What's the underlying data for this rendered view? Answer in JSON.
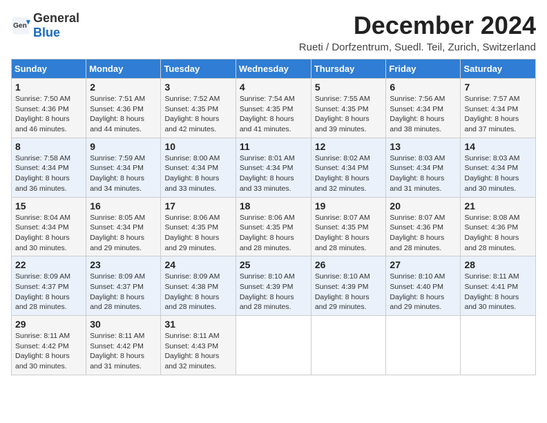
{
  "header": {
    "logo_general": "General",
    "logo_blue": "Blue",
    "month_title": "December 2024",
    "location": "Rueti / Dorfzentrum, Suedl. Teil, Zurich, Switzerland"
  },
  "calendar": {
    "weekdays": [
      "Sunday",
      "Monday",
      "Tuesday",
      "Wednesday",
      "Thursday",
      "Friday",
      "Saturday"
    ],
    "weeks": [
      [
        {
          "day": "1",
          "sunrise": "7:50 AM",
          "sunset": "4:36 PM",
          "daylight": "8 hours and 46 minutes."
        },
        {
          "day": "2",
          "sunrise": "7:51 AM",
          "sunset": "4:36 PM",
          "daylight": "8 hours and 44 minutes."
        },
        {
          "day": "3",
          "sunrise": "7:52 AM",
          "sunset": "4:35 PM",
          "daylight": "8 hours and 42 minutes."
        },
        {
          "day": "4",
          "sunrise": "7:54 AM",
          "sunset": "4:35 PM",
          "daylight": "8 hours and 41 minutes."
        },
        {
          "day": "5",
          "sunrise": "7:55 AM",
          "sunset": "4:35 PM",
          "daylight": "8 hours and 39 minutes."
        },
        {
          "day": "6",
          "sunrise": "7:56 AM",
          "sunset": "4:34 PM",
          "daylight": "8 hours and 38 minutes."
        },
        {
          "day": "7",
          "sunrise": "7:57 AM",
          "sunset": "4:34 PM",
          "daylight": "8 hours and 37 minutes."
        }
      ],
      [
        {
          "day": "8",
          "sunrise": "7:58 AM",
          "sunset": "4:34 PM",
          "daylight": "8 hours and 36 minutes."
        },
        {
          "day": "9",
          "sunrise": "7:59 AM",
          "sunset": "4:34 PM",
          "daylight": "8 hours and 34 minutes."
        },
        {
          "day": "10",
          "sunrise": "8:00 AM",
          "sunset": "4:34 PM",
          "daylight": "8 hours and 33 minutes."
        },
        {
          "day": "11",
          "sunrise": "8:01 AM",
          "sunset": "4:34 PM",
          "daylight": "8 hours and 33 minutes."
        },
        {
          "day": "12",
          "sunrise": "8:02 AM",
          "sunset": "4:34 PM",
          "daylight": "8 hours and 32 minutes."
        },
        {
          "day": "13",
          "sunrise": "8:03 AM",
          "sunset": "4:34 PM",
          "daylight": "8 hours and 31 minutes."
        },
        {
          "day": "14",
          "sunrise": "8:03 AM",
          "sunset": "4:34 PM",
          "daylight": "8 hours and 30 minutes."
        }
      ],
      [
        {
          "day": "15",
          "sunrise": "8:04 AM",
          "sunset": "4:34 PM",
          "daylight": "8 hours and 30 minutes."
        },
        {
          "day": "16",
          "sunrise": "8:05 AM",
          "sunset": "4:34 PM",
          "daylight": "8 hours and 29 minutes."
        },
        {
          "day": "17",
          "sunrise": "8:06 AM",
          "sunset": "4:35 PM",
          "daylight": "8 hours and 29 minutes."
        },
        {
          "day": "18",
          "sunrise": "8:06 AM",
          "sunset": "4:35 PM",
          "daylight": "8 hours and 28 minutes."
        },
        {
          "day": "19",
          "sunrise": "8:07 AM",
          "sunset": "4:35 PM",
          "daylight": "8 hours and 28 minutes."
        },
        {
          "day": "20",
          "sunrise": "8:07 AM",
          "sunset": "4:36 PM",
          "daylight": "8 hours and 28 minutes."
        },
        {
          "day": "21",
          "sunrise": "8:08 AM",
          "sunset": "4:36 PM",
          "daylight": "8 hours and 28 minutes."
        }
      ],
      [
        {
          "day": "22",
          "sunrise": "8:09 AM",
          "sunset": "4:37 PM",
          "daylight": "8 hours and 28 minutes."
        },
        {
          "day": "23",
          "sunrise": "8:09 AM",
          "sunset": "4:37 PM",
          "daylight": "8 hours and 28 minutes."
        },
        {
          "day": "24",
          "sunrise": "8:09 AM",
          "sunset": "4:38 PM",
          "daylight": "8 hours and 28 minutes."
        },
        {
          "day": "25",
          "sunrise": "8:10 AM",
          "sunset": "4:39 PM",
          "daylight": "8 hours and 28 minutes."
        },
        {
          "day": "26",
          "sunrise": "8:10 AM",
          "sunset": "4:39 PM",
          "daylight": "8 hours and 29 minutes."
        },
        {
          "day": "27",
          "sunrise": "8:10 AM",
          "sunset": "4:40 PM",
          "daylight": "8 hours and 29 minutes."
        },
        {
          "day": "28",
          "sunrise": "8:11 AM",
          "sunset": "4:41 PM",
          "daylight": "8 hours and 30 minutes."
        }
      ],
      [
        {
          "day": "29",
          "sunrise": "8:11 AM",
          "sunset": "4:42 PM",
          "daylight": "8 hours and 30 minutes."
        },
        {
          "day": "30",
          "sunrise": "8:11 AM",
          "sunset": "4:42 PM",
          "daylight": "8 hours and 31 minutes."
        },
        {
          "day": "31",
          "sunrise": "8:11 AM",
          "sunset": "4:43 PM",
          "daylight": "8 hours and 32 minutes."
        },
        null,
        null,
        null,
        null
      ]
    ]
  }
}
